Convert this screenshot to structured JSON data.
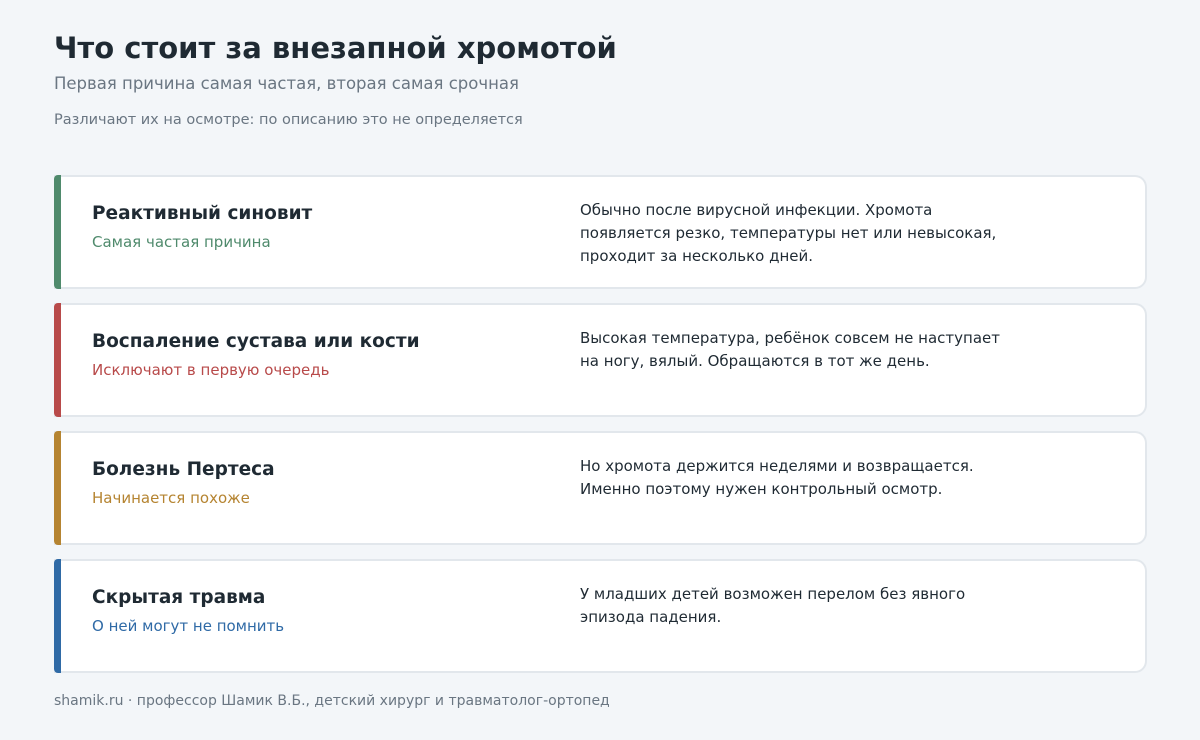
{
  "header": {
    "title": "Что стоит за внезапной хромотой",
    "subtitle": "Первая причина самая частая, вторая самая срочная",
    "note": "Различают их на осмотре: по описанию это не определяется"
  },
  "cards": [
    {
      "title": "Реактивный синовит",
      "tag": "Самая частая причина",
      "description": "Обычно после вирусной инфекции. Хромота появляется резко, температуры нет или невысокая, проходит за несколько дней.",
      "accent": "#4f8a6c"
    },
    {
      "title": "Воспаление сустава или кости",
      "tag": "Исключают в первую очередь",
      "description": "Высокая температура, ребёнок совсем не наступает на ногу, вялый. Обращаются в тот же день.",
      "accent": "#b84a4a"
    },
    {
      "title": "Болезнь Пертеса",
      "tag": "Начинается похоже",
      "description": "Но хромота держится неделями и возвращается. Именно поэтому нужен контрольный осмотр.",
      "accent": "#b58431"
    },
    {
      "title": "Скрытая травма",
      "tag": "О ней могут не помнить",
      "description": "У младших детей возможен перелом без явного эпизода падения.",
      "accent": "#2f6aa6"
    }
  ],
  "footer": {
    "text": "shamik.ru · профессор Шамик В.Б., детский хирург и травматолог-ортопед"
  }
}
